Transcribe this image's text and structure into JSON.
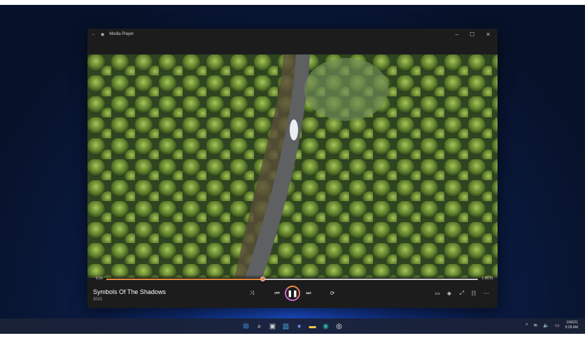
{
  "window": {
    "title": "Media Player",
    "minimize": "–",
    "maximize": "☐",
    "close": "✕",
    "back": "←"
  },
  "player": {
    "elapsed": "6:29",
    "duration": "1:36:21",
    "progress_fraction": 0.42,
    "song_title": "Symbols Of The Shadows",
    "year": "2021"
  },
  "controls": {
    "shuffle": "⤨",
    "previous": "⏮",
    "pause": "❚❚",
    "next": "⏭",
    "repeat": "⟳",
    "miniplayer": "▭",
    "cast": "◈",
    "fullscreen": "⤢",
    "playlist": "☷",
    "more": "⋯"
  },
  "taskbar": {
    "icons": [
      {
        "name": "start-icon",
        "glyph": "⊞",
        "color": "#3ea0f0"
      },
      {
        "name": "search-icon",
        "glyph": "⌕",
        "color": "#ffffff"
      },
      {
        "name": "task-view-icon",
        "glyph": "▣",
        "color": "#cccccc"
      },
      {
        "name": "widgets-icon",
        "glyph": "▥",
        "color": "#4ab0e0"
      },
      {
        "name": "chat-icon",
        "glyph": "●",
        "color": "#7b7fe0"
      },
      {
        "name": "file-explorer-icon",
        "glyph": "▬",
        "color": "#f2c94c"
      },
      {
        "name": "edge-icon",
        "glyph": "◉",
        "color": "#2fb3a0"
      },
      {
        "name": "media-player-icon",
        "glyph": "◎",
        "color": "#ffffff"
      }
    ],
    "tray": {
      "chevron": "^",
      "wifi": "≋",
      "volume": "🔈",
      "battery": "▭",
      "date": "10/6/21",
      "time": "9:28 AM"
    }
  },
  "colors": {
    "accent": "#e38a3f"
  }
}
